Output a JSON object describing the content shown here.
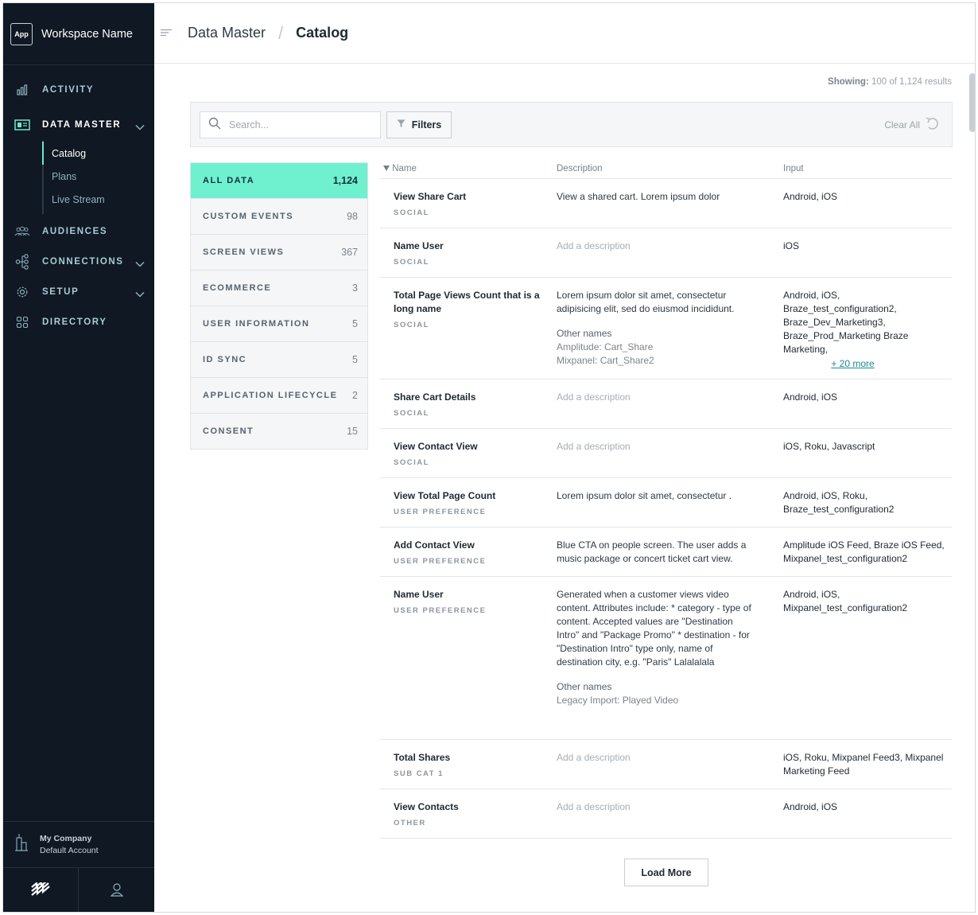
{
  "workspace": {
    "logo": "App",
    "name": "Workspace Name"
  },
  "nav": {
    "activity": "ACTIVITY",
    "data_master": "DATA MASTER",
    "sub_items": [
      "Catalog",
      "Plans",
      "Live Stream"
    ],
    "audiences": "AUDIENCES",
    "connections": "CONNECTIONS",
    "setup": "SETUP",
    "directory": "DIRECTORY"
  },
  "company": {
    "name": "My Company",
    "account": "Default Account"
  },
  "header": {
    "crumb1": "Data Master",
    "separator": "/",
    "crumb2": "Catalog"
  },
  "showing": {
    "label": "Showing:",
    "value": "100 of 1,124 results"
  },
  "toolbar": {
    "search_placeholder": "Search...",
    "filters": "Filters",
    "clear_all": "Clear All"
  },
  "categories": [
    {
      "label": "ALL DATA",
      "count": "1,124"
    },
    {
      "label": "CUSTOM EVENTS",
      "count": "98"
    },
    {
      "label": "SCREEN VIEWS",
      "count": "367"
    },
    {
      "label": "ECOMMERCE",
      "count": "3"
    },
    {
      "label": "USER INFORMATION",
      "count": "5"
    },
    {
      "label": "ID SYNC",
      "count": "5"
    },
    {
      "label": "APPLICATION LIFECYCLE",
      "count": "2"
    },
    {
      "label": "CONSENT",
      "count": "15"
    }
  ],
  "table": {
    "headers": {
      "name": "Name",
      "description": "Description",
      "input": "Input"
    },
    "add_description": "Add a description",
    "other_names_label": "Other names",
    "rows": [
      {
        "name": "View Share Cart",
        "category": "SOCIAL",
        "description": "View a shared cart. Lorem ipsum dolor",
        "input": "Android, iOS"
      },
      {
        "name": "Name User",
        "category": "SOCIAL",
        "description": "",
        "input": "iOS"
      },
      {
        "name": "Total Page Views Count that is a long name",
        "category": "SOCIAL",
        "description": "Lorem ipsum dolor sit amet, consectetur adipisicing elit, sed do eiusmod incididunt.",
        "other_names": [
          "Amplitude: Cart_Share",
          "Mixpanel: Cart_Share2"
        ],
        "input": "Android, iOS, Braze_test_configuration2, Braze_Dev_Marketing3, Braze_Prod_Marketing Braze Marketing,",
        "more": "+ 20 more"
      },
      {
        "name": "Share Cart Details",
        "category": "SOCIAL",
        "description": "",
        "input": "Android, iOS"
      },
      {
        "name": "View Contact View",
        "category": "SOCIAL",
        "description": "",
        "input": "iOS, Roku, Javascript"
      },
      {
        "name": "View Total Page Count",
        "category": "USER PREFERENCE",
        "description": "Lorem ipsum dolor sit amet, consectetur .",
        "input": "Android, iOS, Roku, Braze_test_configuration2"
      },
      {
        "name": "Add Contact View",
        "category": "USER PREFERENCE",
        "description": "Blue CTA on people screen. The user adds a music package or concert ticket cart view.",
        "input": "Amplitude iOS Feed, Braze iOS Feed, Mixpanel_test_configuration2"
      },
      {
        "name": "Name User",
        "category": "USER PREFERENCE",
        "description": "Generated when a customer views video content. Attributes include: * category - type of content. Accepted values are \"Destination Intro\" and \"Package Promo\" * destination - for \"Destination Intro\" type only, name of destination city, e.g. \"Paris\" Lalalalala",
        "other_names": [
          "Legacy Import: Played Video"
        ],
        "input": "Android, iOS, Mixpanel_test_configuration2"
      },
      {
        "name": "Total Shares",
        "category": "SUB CAT 1",
        "description": "",
        "input": "iOS, Roku, Mixpanel Feed3, Mixpanel Marketing Feed"
      },
      {
        "name": "View Contacts",
        "category": "OTHER",
        "description": "",
        "input": "Android, iOS"
      }
    ]
  },
  "load_more": "Load More",
  "colors": {
    "sidebar_bg": "#0f1823",
    "accent": "#6ff0cf",
    "link": "#1c8a96"
  }
}
